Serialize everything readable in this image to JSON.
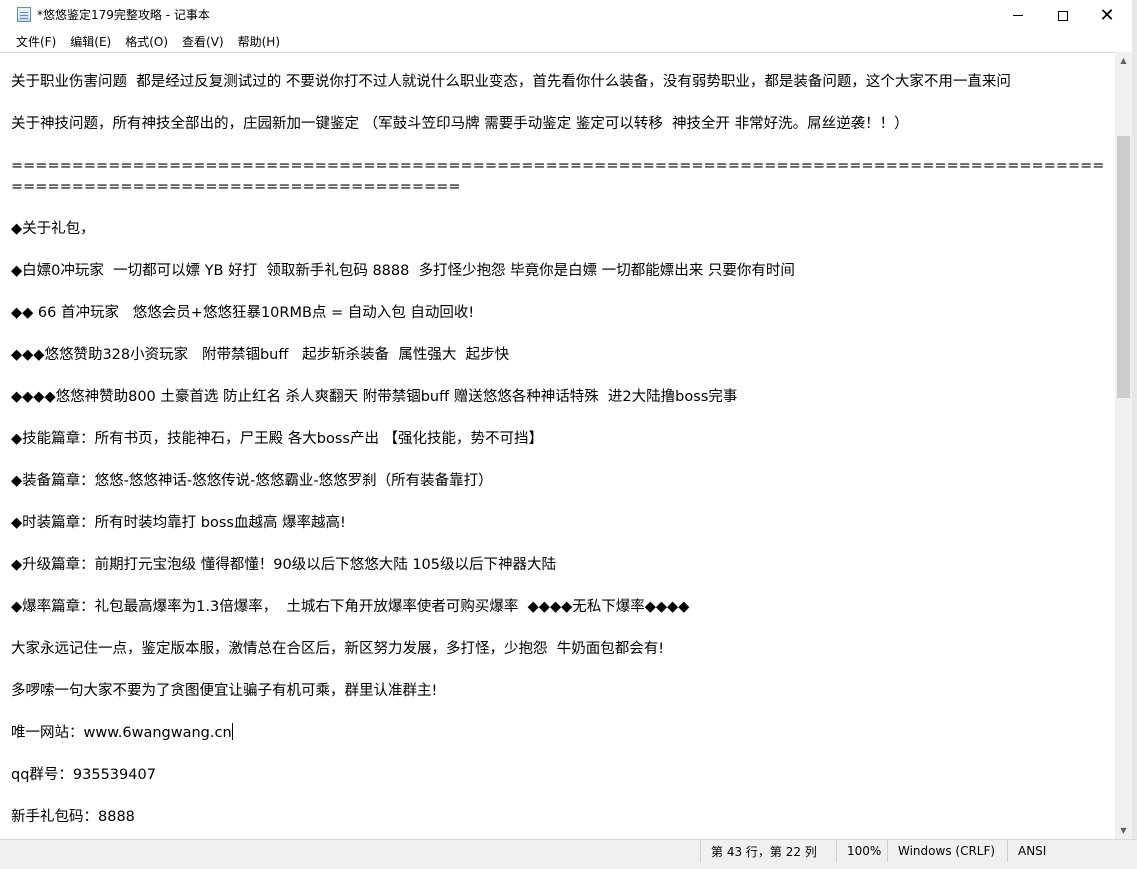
{
  "window": {
    "title": "*悠悠鉴定179完整攻略 - 记事本"
  },
  "menu": {
    "items": [
      {
        "label": "文件(F)"
      },
      {
        "label": "编辑(E)"
      },
      {
        "label": "格式(O)"
      },
      {
        "label": "查看(V)"
      },
      {
        "label": "帮助(H)"
      }
    ]
  },
  "editor": {
    "lines": [
      "关于职业伤害问题  都是经过反复测试过的 不要说你打不过人就说什么职业变态，首先看你什么装备，没有弱势职业，都是装备问题，这个大家不用一直来问",
      "",
      "关于神技问题，所有神技全部出的，庄园新加一键鉴定 （军鼓斗笠印马牌 需要手动鉴定 鉴定可以转移  神技全开 非常好洗。屌丝逆袭！！）",
      "",
      "===============================================================================================================================",
      "",
      "◆关于礼包，",
      "",
      "◆白嫖0冲玩家  一切都可以嫖 YB 好打  领取新手礼包码 8888  多打怪少抱怨 毕竟你是白嫖 一切都能嫖出来 只要你有时间",
      "",
      "◆◆ 66 首冲玩家   悠悠会员+悠悠狂暴10RMB点 = 自动入包 自动回收!",
      "",
      "◆◆◆悠悠赞助328小资玩家   附带禁锢buff   起步斩杀装备  属性强大  起步快",
      "",
      "◆◆◆◆悠悠神赞助800 土豪首选 防止红名 杀人爽翻天 附带禁锢buff 赠送悠悠各种神话特殊  进2大陆撸boss完事",
      "",
      "◆技能篇章：所有书页，技能神石，尸王殿 各大boss产出 【强化技能，势不可挡】",
      "",
      "◆装备篇章：悠悠-悠悠神话-悠悠传说-悠悠霸业-悠悠罗刹（所有装备靠打）",
      "",
      "◆时装篇章：所有时装均靠打 boss血越高 爆率越高!",
      "",
      "◆升级篇章：前期打元宝泡级 懂得都懂！90级以后下悠悠大陆 105级以后下神器大陆",
      "",
      "◆爆率篇章：礼包最高爆率为1.3倍爆率，  土城右下角开放爆率使者可购买爆率  ◆◆◆◆无私下爆率◆◆◆◆",
      "",
      "大家永远记住一点，鉴定版本服，激情总在合区后，新区努力发展，多打怪，少抱怨  牛奶面包都会有!",
      "",
      "多啰嗦一句大家不要为了贪图便宜让骗子有机可乘，群里认准群主!",
      "",
      "唯一网站：www.6wangwang.cn",
      "",
      "qq群号：935539407",
      "",
      "新手礼包码：8888"
    ]
  },
  "status": {
    "position": "第 43 行，第 22 列",
    "zoom": "100%",
    "line_ending": "Windows (CRLF)",
    "encoding": "ANSI"
  }
}
